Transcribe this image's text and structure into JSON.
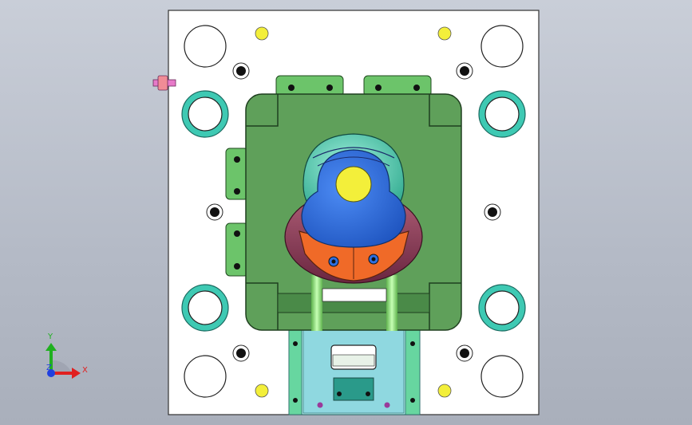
{
  "colors": {
    "background_top": "#c9ced8",
    "background_bottom": "#a9afbb",
    "plate": "#ffffff",
    "cavity_green": "#5fa05a",
    "insert_green": "#6cc46a",
    "guide_ring": "#3ec9b3",
    "support_cyan": "#a8e6e6",
    "part_blue": "#2f6fe0",
    "part_yellow": "#f3ef3a",
    "part_orange": "#f06a28",
    "part_maroon": "#8a3a5a",
    "runner_green": "#9df08a",
    "connector_pink": "#e77ac9",
    "axis_x": "#e02020",
    "axis_y": "#20b020",
    "axis_z": "#2040e0"
  },
  "triad": {
    "x_label": "X",
    "y_label": "Y",
    "z_label": "Z"
  },
  "icons": {
    "triad": "coordinate-triad-icon"
  }
}
